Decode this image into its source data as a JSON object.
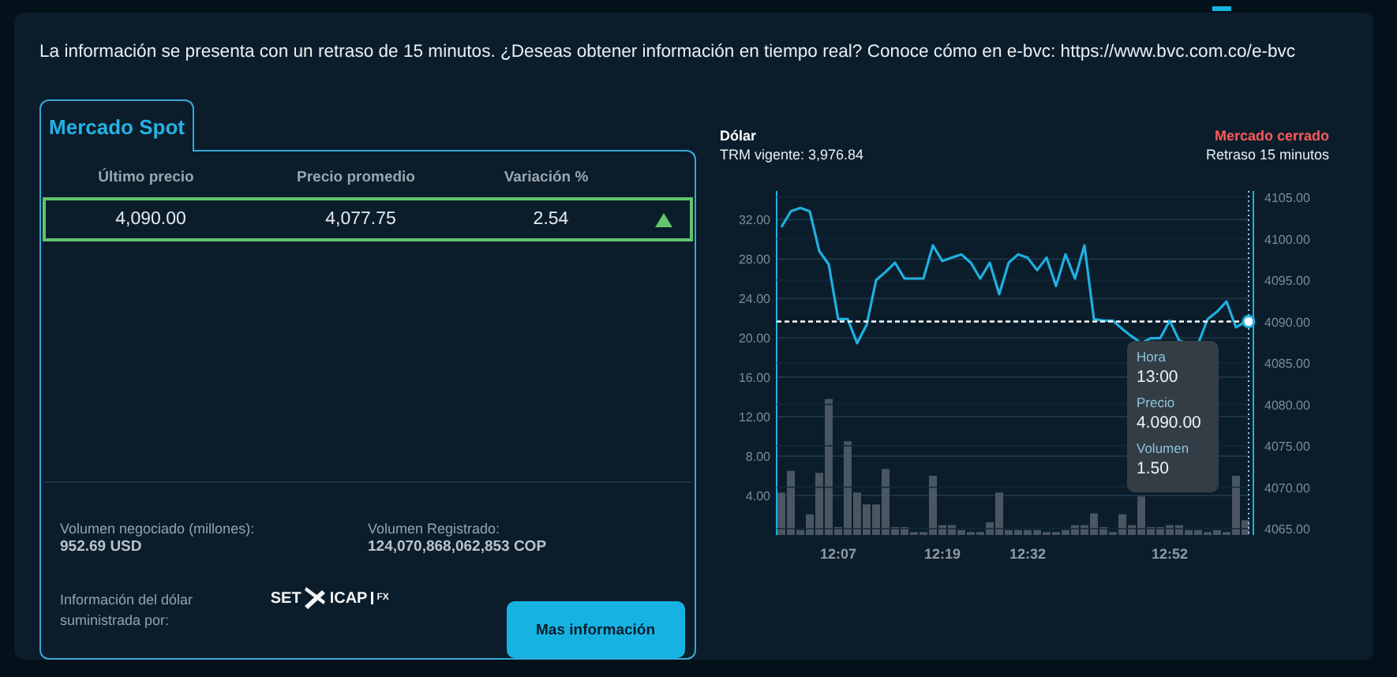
{
  "notice": "La información se presenta con un retraso de 15 minutos. ¿Deseas obtener información en tiempo real? Conoce cómo en e-bvc: https://www.bvc.com.co/e-bvc",
  "spot": {
    "tab": {
      "label": "Mercado Spot",
      "selected": true
    },
    "table": {
      "columns": [
        "Último precio",
        "Precio promedio",
        "Variación %"
      ],
      "rows": [
        {
          "cells": [
            "4,090.00",
            "4,077.75",
            "2.54"
          ],
          "selected": true
        }
      ]
    },
    "stats": [
      {
        "label": "Volumen negociado (millones):",
        "value": "952.69 USD"
      },
      {
        "label": "Volumen Registrado:",
        "value": "124,070,868,062,853 COP"
      }
    ],
    "provider": {
      "label": "Información del dólar suministrada por:",
      "logo": [
        "SET",
        "ICAP",
        "FX"
      ]
    },
    "button": "Mas información"
  },
  "chart": {
    "title": "Dólar",
    "subtitle": "TRM vigente: 3,976.84",
    "status": "Mercado cerrado",
    "delay": "Retraso 15 minutos",
    "tooltip": [
      {
        "label": "Hora",
        "value": "13:00"
      },
      {
        "label": "Precio",
        "value": "4.090.00"
      },
      {
        "label": "Volumen",
        "value": "1.50"
      }
    ],
    "chart_data": {
      "type": "line",
      "ref_lines": [
        {
          "axis": "y",
          "value": 4090
        }
      ],
      "series": [
        {
          "color": "#1fb0e0",
          "values": [
            4101.4,
            4103.3,
            4103.7,
            4103.3,
            4098.5,
            4096.9,
            4090.3,
            4090.3,
            4087.4,
            4089.6,
            4095,
            4096,
            4097.1,
            4095.2,
            4095.2,
            4095.2,
            4099.2,
            4097.3,
            4097.7,
            4098.1,
            4097.1,
            4095.2,
            4097.1,
            4093.3,
            4097.1,
            4098.1,
            4097.7,
            4096.2,
            4097.7,
            4094.3,
            4098.1,
            4095.2,
            4099.2,
            4090.3,
            4090.1,
            4090.1,
            4089.1,
            4088.2,
            4087.4,
            4088,
            4088,
            4090.1,
            4087.7,
            4087.3,
            4087.3,
            4090.3,
            4091.2,
            4092.4,
            4089.3,
            4090
          ]
        }
      ],
      "ylim": [
        4065,
        4105
      ],
      "yticks": [
        {
          "value": 4065,
          "label": "4065.00"
        },
        {
          "value": 4070,
          "label": "4070.00"
        },
        {
          "value": 4075,
          "label": "4075.00"
        },
        {
          "value": 4080,
          "label": "4080.00"
        },
        {
          "value": 4085,
          "label": "4085.00"
        },
        {
          "value": 4090,
          "label": "4090.00"
        },
        {
          "value": 4095,
          "label": "4095.00"
        },
        {
          "value": 4100,
          "label": "4100.00"
        },
        {
          "value": 4105,
          "label": "4105.00"
        }
      ],
      "grid": true
    },
    "volume": {
      "chart_data": {
        "type": "bar",
        "categories": [
          null,
          null,
          null,
          null,
          null,
          null,
          "12:07",
          null,
          null,
          null,
          null,
          null,
          null,
          null,
          null,
          null,
          null,
          "12:19",
          null,
          null,
          null,
          null,
          null,
          null,
          null,
          null,
          "12:32",
          null,
          null,
          null,
          null,
          null,
          null,
          null,
          null,
          null,
          null,
          null,
          null,
          null,
          null,
          "12:52",
          null,
          null,
          null,
          null,
          null,
          null,
          null,
          null
        ],
        "series": [
          {
            "color": "#4a5661",
            "values": [
              4.3,
              6.5,
              0.5,
              2.1,
              6.3,
              13.8,
              0.8,
              9.5,
              4.3,
              3.1,
              3.1,
              6.7,
              0.8,
              0.8,
              0.3,
              0.3,
              6,
              1,
              1,
              0.5,
              0.3,
              0.3,
              1.3,
              4.3,
              0.5,
              0.5,
              0.5,
              0.5,
              0.3,
              0.3,
              0.5,
              1,
              1,
              2.2,
              0.8,
              0.3,
              2.1,
              1,
              3.9,
              0.8,
              0.8,
              1,
              1,
              0.5,
              0.5,
              0.3,
              0.5,
              0.3,
              6,
              1.5
            ]
          }
        ],
        "ylim": [
          0,
          34.9
        ],
        "grid": true,
        "yticks": [
          {
            "value": 4,
            "label": "4.00"
          },
          {
            "value": 8,
            "label": "8.00"
          },
          {
            "value": 12,
            "label": "12.00"
          },
          {
            "value": 16,
            "label": "16.00"
          },
          {
            "value": 20,
            "label": "20.00"
          },
          {
            "value": 24,
            "label": "24.00"
          },
          {
            "value": 28,
            "label": "28.00"
          },
          {
            "value": 32,
            "label": "32.00"
          }
        ]
      }
    }
  }
}
